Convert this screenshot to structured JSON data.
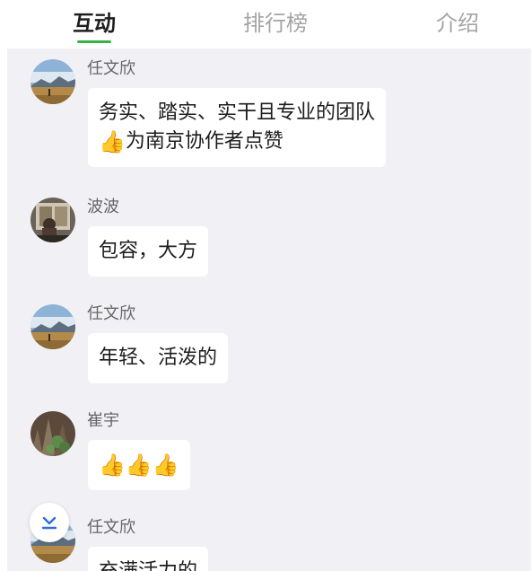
{
  "tabs": [
    {
      "label": "互动",
      "active": true
    },
    {
      "label": "排行榜",
      "active": false
    },
    {
      "label": "介绍",
      "active": false
    }
  ],
  "accent_color": "#35b34a",
  "messages": [
    {
      "name": "任文欣",
      "line1": "务实、踏实、实干且专业的团队",
      "line2": "为南京协作者点赞",
      "line2_icon": "thumbs-up-icon"
    },
    {
      "name": "波波",
      "text": "包容，大方"
    },
    {
      "name": "任文欣",
      "text": "年轻、活泼的"
    },
    {
      "name": "崔宇",
      "icons": [
        "thumbs-up-icon",
        "thumbs-up-icon",
        "thumbs-up-icon"
      ]
    },
    {
      "name": "任文欣",
      "text": "充满活力的"
    }
  ],
  "scroll_button": {
    "icon": "scroll-to-bottom-icon"
  }
}
